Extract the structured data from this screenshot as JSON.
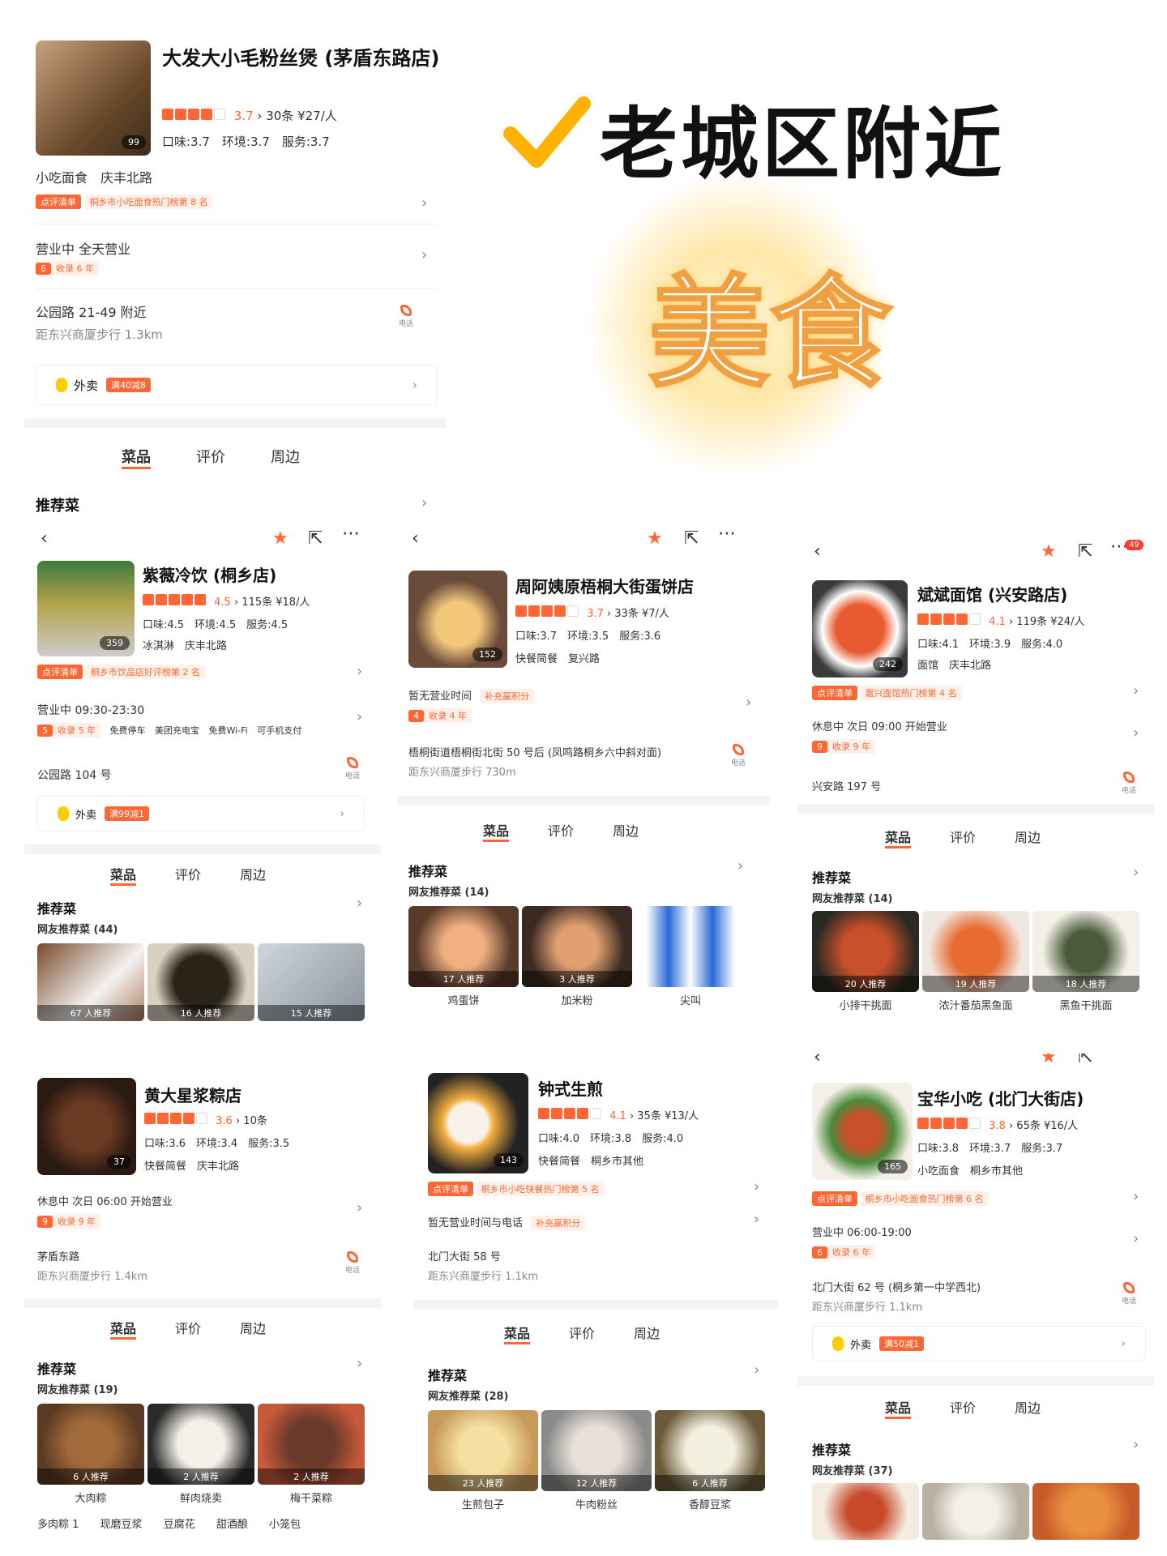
{
  "hero": {
    "title": "老城区附近",
    "big": "美食",
    "check_color": "#ffb300",
    "accent": "#ff6633"
  },
  "p1": {
    "name": "大发大小毛粉丝煲 (茅盾东路店)",
    "rating": "3.7",
    "reviews": "30条",
    "price": "¥27/人",
    "scores": "口味:3.7　环境:3.7　服务:3.7",
    "photos": "99",
    "category": "小吃面食　庆丰北路",
    "rank_badge": "点评清单",
    "rank_text": "桐乡市小吃面食热门榜第 8 名",
    "hours": "营业中 全天营业",
    "years_num": "6",
    "years_text": "收录 6 年",
    "address": "公园路 21-49 附近",
    "distance": "距东兴商厦步行 1.3km",
    "phone": "电话",
    "waimai": "外卖",
    "waimai_badge": "满40减8",
    "tabs": [
      "菜品",
      "评价",
      "周边"
    ],
    "rec": "推荐菜"
  },
  "p2": {
    "name": "紫薇冷饮 (桐乡店)",
    "rating": "4.5",
    "reviews": "115条",
    "price": "¥18/人",
    "scores": "口味:4.5　环境:4.5　服务:4.5",
    "photos": "359",
    "category": "冰淇淋　庆丰北路",
    "rank_badge": "点评清单",
    "rank_text": "桐乡市饮品店好评榜第 2 名",
    "hours": "营业中 09:30-23:30",
    "years_num": "5",
    "years_text": "收录 5 年",
    "facilities": [
      "免费停车",
      "美团充电宝",
      "免费Wi-Fi",
      "可手机支付"
    ],
    "address": "公园路 104 号",
    "phone": "电话",
    "waimai": "外卖",
    "waimai_badge": "满99减1",
    "tabs": [
      "菜品",
      "评价",
      "周边"
    ],
    "rec": "推荐菜",
    "rec_sub": "网友推荐菜 (44)",
    "dishes": [
      {
        "count": "67 人推荐"
      },
      {
        "count": "16 人推荐"
      },
      {
        "count": "15 人推荐"
      }
    ]
  },
  "p3": {
    "name": "周阿姨原梧桐大街蛋饼店",
    "rating": "3.7",
    "reviews": "33条",
    "price": "¥7/人",
    "scores": "口味:3.7　环境:3.5　服务:3.6",
    "photos": "152",
    "category": "快餐简餐　复兴路",
    "hours": "暂无营业时间",
    "hours_tag": "补充赢积分",
    "years_num": "4",
    "years_text": "收录 4 年",
    "address": "梧桐街道梧桐街北街 50 号后 (凤鸣路桐乡六中斜对面)",
    "distance": "距东兴商厦步行 730m",
    "phone": "电话",
    "tabs": [
      "菜品",
      "评价",
      "周边"
    ],
    "rec": "推荐菜",
    "rec_sub": "网友推荐菜 (14)",
    "dishes": [
      {
        "count": "17 人推荐",
        "name": "鸡蛋饼"
      },
      {
        "count": "3 人推荐",
        "name": "加米粉"
      },
      {
        "count": "",
        "name": "尖叫"
      }
    ]
  },
  "p4": {
    "name": "斌斌面馆 (兴安路店)",
    "rating": "4.1",
    "reviews": "119条",
    "price": "¥24/人",
    "scores": "口味:4.1　环境:3.9　服务:4.0",
    "photos": "242",
    "category": "面馆　庆丰北路",
    "rank_badge": "点评清单",
    "rank_text": "嘉兴面馆热门榜第 4 名",
    "hours": "休息中 次日 09:00 开始营业",
    "years_num": "9",
    "years_text": "收录 9 年",
    "address": "兴安路 197 号",
    "phone": "电话",
    "notif": "49",
    "tabs": [
      "菜品",
      "评价",
      "周边"
    ],
    "rec": "推荐菜",
    "rec_sub": "网友推荐菜 (14)",
    "dishes": [
      {
        "count": "20 人推荐",
        "name": "小排干挑面"
      },
      {
        "count": "19 人推荐",
        "name": "浓汁番茄黑鱼面"
      },
      {
        "count": "18 人推荐",
        "name": "黑鱼干挑面"
      }
    ]
  },
  "p5": {
    "name": "黄大星浆粽店",
    "rating": "3.6",
    "reviews": "10条",
    "scores": "口味:3.6　环境:3.4　服务:3.5",
    "photos": "37",
    "category": "快餐简餐　庆丰北路",
    "hours": "休息中 次日 06:00 开始营业",
    "years_num": "9",
    "years_text": "收录 9 年",
    "address": "茅盾东路",
    "distance": "距东兴商厦步行 1.4km",
    "phone": "电话",
    "tabs": [
      "菜品",
      "评价",
      "周边"
    ],
    "rec": "推荐菜",
    "rec_sub": "网友推荐菜 (19)",
    "dishes": [
      {
        "count": "6 人推荐",
        "name": "大肉粽"
      },
      {
        "count": "2 人推荐",
        "name": "鲜肉烧卖"
      },
      {
        "count": "2 人推荐",
        "name": "梅干菜粽"
      }
    ],
    "tags": [
      "多肉粽 1",
      "现磨豆浆",
      "豆腐花",
      "甜酒酿",
      "小笼包"
    ]
  },
  "p6": {
    "name": "钟式生煎",
    "rating": "4.1",
    "reviews": "35条",
    "price": "¥13/人",
    "scores": "口味:4.0　环境:3.8　服务:4.0",
    "photos": "143",
    "category": "快餐简餐　桐乡市其他",
    "rank_badge": "点评清单",
    "rank_text": "桐乡市小吃快餐热门榜第 5 名",
    "hours": "暂无营业时间与电话",
    "hours_tag": "补充赢积分",
    "address": "北门大街 58 号",
    "distance": "距东兴商厦步行 1.1km",
    "tabs": [
      "菜品",
      "评价",
      "周边"
    ],
    "rec": "推荐菜",
    "rec_sub": "网友推荐菜 (28)",
    "dishes": [
      {
        "count": "23 人推荐",
        "name": "生煎包子"
      },
      {
        "count": "12 人推荐",
        "name": "牛肉粉丝"
      },
      {
        "count": "6 人推荐",
        "name": "香醇豆浆"
      }
    ]
  },
  "p7": {
    "name": "宝华小吃 (北门大街店)",
    "rating": "3.8",
    "reviews": "65条",
    "price": "¥16/人",
    "scores": "口味:3.8　环境:3.7　服务:3.7",
    "photos": "165",
    "category": "小吃面食　桐乡市其他",
    "rank_badge": "点评清单",
    "rank_text": "桐乡市小吃面食热门榜第 6 名",
    "hours": "营业中 06:00-19:00",
    "years_num": "6",
    "years_text": "收录 6 年",
    "address": "北门大街 62 号 (桐乡第一中学西北)",
    "distance": "距东兴商厦步行 1.1km",
    "phone": "电话",
    "waimai": "外卖",
    "waimai_badge": "满50减1",
    "tabs": [
      "菜品",
      "评价",
      "周边"
    ],
    "rec": "推荐菜",
    "rec_sub": "网友推荐菜 (37)"
  }
}
